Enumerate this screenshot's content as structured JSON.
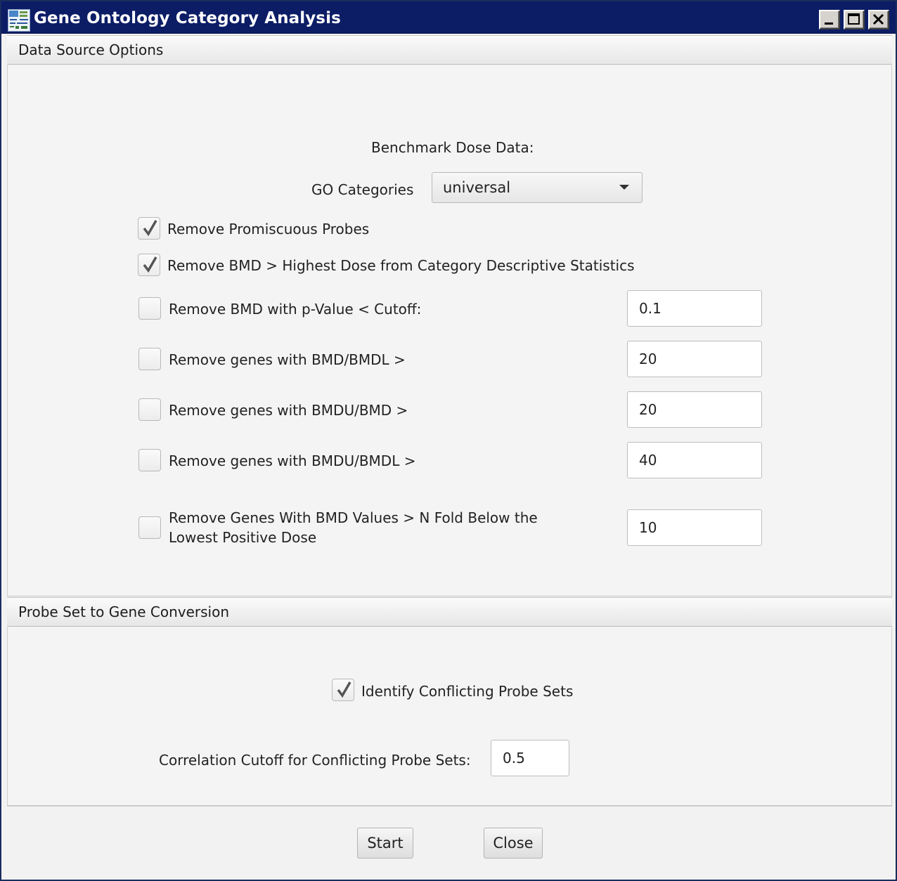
{
  "window": {
    "title": "Gene Ontology Category Analysis",
    "app_icon": "bmd-express-app-icon"
  },
  "data_source": {
    "header": "Data Source Options",
    "benchmark_label": "Benchmark Dose Data:",
    "go_label": "GO Categories",
    "go_selected": "universal",
    "filters": [
      {
        "label": "Remove Promiscuous Probes",
        "checked": true
      },
      {
        "label": "Remove BMD > Highest Dose from Category Descriptive Statistics",
        "checked": true
      },
      {
        "label": "Remove BMD with p-Value < Cutoff:",
        "checked": false,
        "value": "0.1"
      },
      {
        "label": "Remove genes with BMD/BMDL >",
        "checked": false,
        "value": "20"
      },
      {
        "label": "Remove genes with BMDU/BMD >",
        "checked": false,
        "value": "20"
      },
      {
        "label": "Remove genes with BMDU/BMDL >",
        "checked": false,
        "value": "40"
      },
      {
        "label": "Remove Genes With BMD Values > N Fold Below the Lowest Positive Dose",
        "checked": false,
        "value": "10"
      }
    ]
  },
  "probe_conversion": {
    "header": "Probe Set to Gene Conversion",
    "identify_label": "Identify Conflicting Probe Sets",
    "identify_checked": true,
    "correlation_label": "Correlation Cutoff for Conflicting Probe Sets:",
    "correlation_value": "0.5"
  },
  "buttons": {
    "start": "Start",
    "close": "Close"
  },
  "colors": {
    "titlebar": "#0c1d66",
    "panel": "#f4f4f4"
  }
}
